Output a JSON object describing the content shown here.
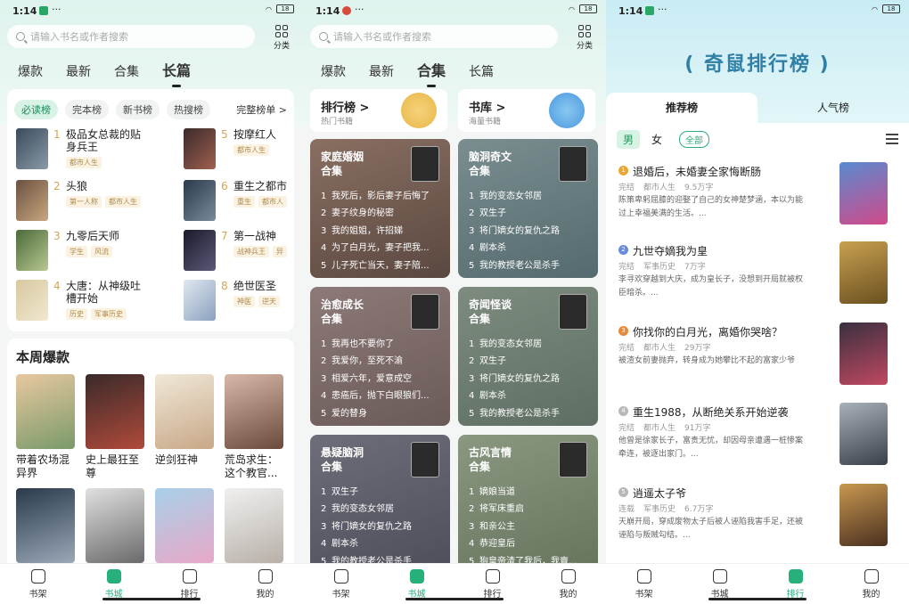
{
  "status": {
    "left": {
      "time": "1:14",
      "net": "6.30\nKB/s",
      "battery": "18"
    },
    "middle": {
      "time": "1:14",
      "net": "1.97\nKB/s",
      "battery": "18"
    },
    "right": {
      "time": "1:14",
      "net": "6.30\nKB/s",
      "battery": "18"
    }
  },
  "search": {
    "placeholder": "请输入书名或作者搜索",
    "category_label": "分类"
  },
  "top_tabs": [
    "爆款",
    "最新",
    "合集",
    "长篇"
  ],
  "screen1": {
    "pills": [
      "必读榜",
      "完本榜",
      "新书榜",
      "热搜榜"
    ],
    "more_label": "完整榜单 >",
    "rank_left": [
      {
        "num": "1",
        "title": "极品女总裁的贴身兵王",
        "tags": [
          "都市人生"
        ]
      },
      {
        "num": "2",
        "title": "头狼",
        "tags": [
          "第一人称",
          "都市人生"
        ]
      },
      {
        "num": "3",
        "title": "九零后天师",
        "tags": [
          "学生",
          "风流"
        ]
      },
      {
        "num": "4",
        "title": "大唐：从神级吐槽开始",
        "tags": [
          "历史",
          "军事历史"
        ]
      }
    ],
    "rank_right": [
      {
        "num": "5",
        "title": "按摩红人",
        "tags": [
          "都市人生"
        ]
      },
      {
        "num": "6",
        "title": "重生之都市",
        "tags": [
          "重生",
          "都市人"
        ]
      },
      {
        "num": "7",
        "title": "第一战神",
        "tags": [
          "战神兵王",
          "异"
        ]
      },
      {
        "num": "8",
        "title": "绝世医圣",
        "tags": [
          "神医",
          "逆天"
        ]
      }
    ],
    "weekly_title": "本周爆款",
    "weekly_books": [
      "带着农场混异界",
      "史上最狂至尊",
      "逆剑狂神",
      "荒岛求生：这个教官..."
    ],
    "weekly_books_row2": [
      "",
      "",
      "",
      ""
    ]
  },
  "screen2": {
    "rank_card": {
      "title": "排行榜 >",
      "sub": "热门书籍"
    },
    "library_card": {
      "title": "书库 >",
      "sub": "海量书籍"
    },
    "collections": [
      {
        "title": "家庭婚姻\n合集",
        "items": [
          "我死后，影后妻子后悔了",
          "妻子纹身的秘密",
          "我的姐姐，许招娣",
          "为了白月光，妻子把我...",
          "儿子死亡当天，妻子陪..."
        ]
      },
      {
        "title": "脑洞奇文\n合集",
        "items": [
          "我的变态女邻居",
          "双生子",
          "将门嫡女的复仇之路",
          "剧本杀",
          "我的教授老公是杀手"
        ]
      },
      {
        "title": "治愈成长\n合集",
        "items": [
          "我再也不要你了",
          "我爱你，至死不渝",
          "相爱六年，爱意成空",
          "患癌后，抛下白眼狼们...",
          "爱的替身"
        ]
      },
      {
        "title": "奇闻怪谈\n合集",
        "items": [
          "我的变态女邻居",
          "双生子",
          "将门嫡女的复仇之路",
          "剧本杀",
          "我的教授老公是杀手"
        ]
      },
      {
        "title": "悬疑脑洞\n合集",
        "items": [
          "双生子",
          "我的变态女邻居",
          "将门嫡女的复仇之路",
          "剧本杀",
          "我的教授老公是杀手"
        ]
      },
      {
        "title": "古风言情\n合集",
        "items": [
          "嫡娘当道",
          "将军床重启",
          "和亲公主",
          "恭迎皇后",
          "狗皇帝渣了我后，我賣..."
        ]
      }
    ]
  },
  "screen3": {
    "banner_title": "( 奇鼠排行榜 )",
    "tabs": [
      "推荐榜",
      "人气榜"
    ],
    "gender": [
      "男",
      "女"
    ],
    "all_label": "全部",
    "items": [
      {
        "num": "1",
        "title": "退婚后，未婚妻全家悔断肠",
        "status": "完结",
        "genre": "都市人生",
        "words": "9.5万字",
        "desc": "陈策卑躬屈膝的迎娶了自己的女神楚梦涵，本以为能过上幸福美满的生活。..."
      },
      {
        "num": "2",
        "title": "九世夺嫡我为皇",
        "status": "完结",
        "genre": "军事历史",
        "words": "7万字",
        "desc": "李寻欢穿越到大庆，成为皇长子，没想到开局就被权臣暗杀。..."
      },
      {
        "num": "3",
        "title": "你找你的白月光，离婚你哭啥？",
        "status": "完结",
        "genre": "都市人生",
        "words": "29万字",
        "desc": "被渣女前妻抛弃，转身成为她攀比不起的富家少爷"
      },
      {
        "num": "4",
        "title": "重生1988，从断绝关系开始逆袭",
        "status": "完结",
        "genre": "都市人生",
        "words": "91万字",
        "desc": "他曾是徐家长子，富贵无忧，却因母亲遭遇一桩惨案牵连，被逐出家门。..."
      },
      {
        "num": "5",
        "title": "逍遥太子爷",
        "status": "连载",
        "genre": "军事历史",
        "words": "6.7万字",
        "desc": "天崩开局，穿成废物太子后被人诬陷我害手足，还被诬陷与叛贼勾结。..."
      }
    ]
  },
  "nav": [
    "书架",
    "书城",
    "排行",
    "我的"
  ],
  "colors": {
    "accent": "#27b07a",
    "rank_num": "#d8a54a"
  }
}
